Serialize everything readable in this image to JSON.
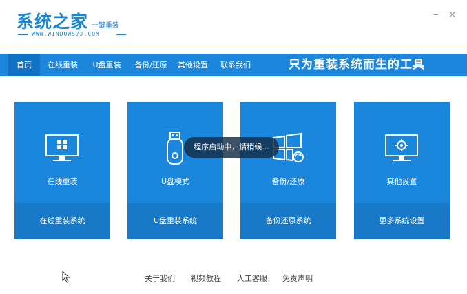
{
  "app": {
    "logo_title": "系统之家",
    "logo_subtitle": "一键重装",
    "logo_url": "WWW.WINDOWS7J.COM",
    "minimize": "–",
    "close": "×"
  },
  "nav": {
    "items": [
      {
        "label": "首页"
      },
      {
        "label": "在线重装"
      },
      {
        "label": "U盘重装"
      },
      {
        "label": "备份/还原"
      },
      {
        "label": "其他设置"
      },
      {
        "label": "联系我们"
      }
    ],
    "active_index": 0,
    "slogan": "只为重装系统而生的工具"
  },
  "cards": [
    {
      "label": "在线重装",
      "action": "在线重装系统",
      "icon": "monitor-windows-icon"
    },
    {
      "label": "U盘模式",
      "action": "U盘重装系统",
      "icon": "usb-drive-icon"
    },
    {
      "label": "备份/还原",
      "action": "备份还原系统",
      "icon": "windows-restore-icon"
    },
    {
      "label": "其他设置",
      "action": "更多系统设置",
      "icon": "monitor-gear-icon"
    }
  ],
  "toast": "程序启动中，请稍候...",
  "footer": {
    "links": [
      {
        "label": "关于我们"
      },
      {
        "label": "视频教程"
      },
      {
        "label": "人工客服"
      },
      {
        "label": "免责声明"
      }
    ]
  },
  "colors": {
    "brand": "#1b86db",
    "nav_active": "#1072c4",
    "card_bottom": "#1779c7"
  }
}
